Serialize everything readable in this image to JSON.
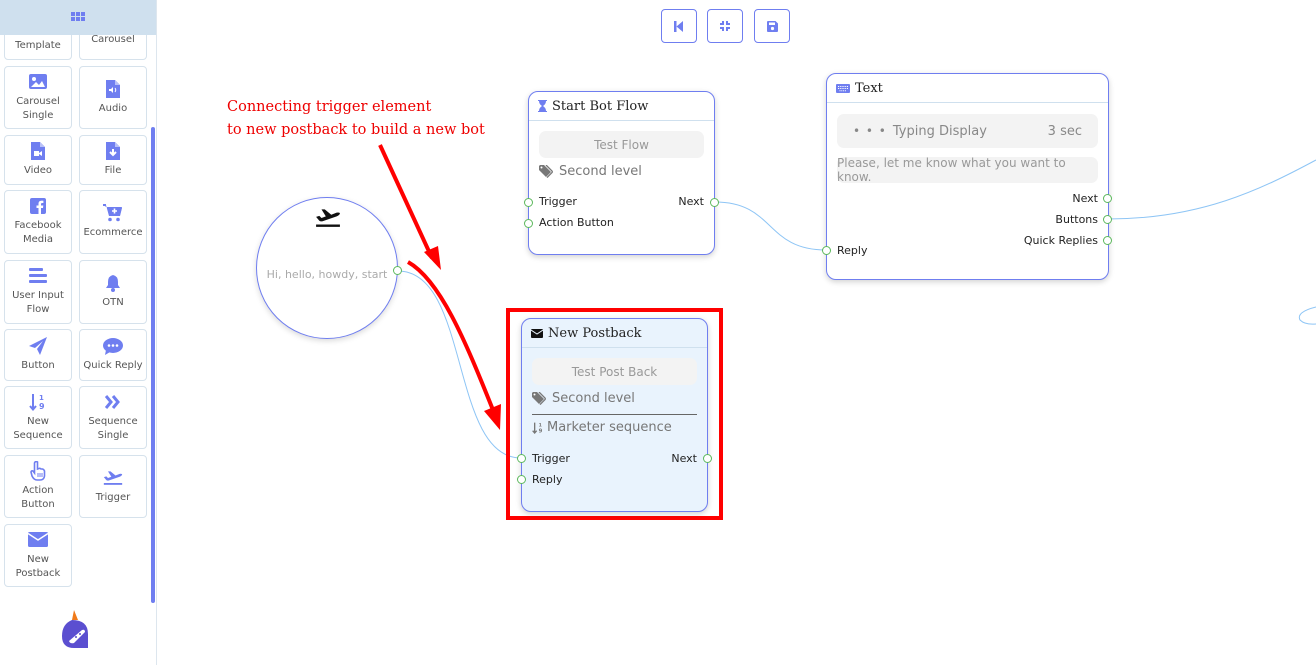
{
  "sidebar": {
    "header_icon": "grid-icon",
    "tiles": [
      {
        "label": "Generic Template",
        "icon": "generic-template-icon"
      },
      {
        "label": "Carousel",
        "icon": "carousel-icon"
      },
      {
        "label": "Carousel Single",
        "icon": "image-icon"
      },
      {
        "label": "Audio",
        "icon": "audio-file-icon"
      },
      {
        "label": "Video",
        "icon": "video-file-icon"
      },
      {
        "label": "File",
        "icon": "file-download-icon"
      },
      {
        "label": "Facebook Media",
        "icon": "facebook-icon"
      },
      {
        "label": "Ecommerce",
        "icon": "cart-plus-icon"
      },
      {
        "label": "User Input Flow",
        "icon": "bars-icon"
      },
      {
        "label": "OTN",
        "icon": "bell-icon"
      },
      {
        "label": "Button",
        "icon": "paper-plane-icon"
      },
      {
        "label": "Quick Reply",
        "icon": "comment-dots-icon"
      },
      {
        "label": "New Sequence",
        "icon": "sort-numeric-icon"
      },
      {
        "label": "Sequence Single",
        "icon": "double-chevron-right-icon"
      },
      {
        "label": "Action Button",
        "icon": "hand-pointer-icon"
      },
      {
        "label": "Trigger",
        "icon": "plane-departure-icon"
      },
      {
        "label": "New Postback",
        "icon": "envelope-icon"
      }
    ]
  },
  "toolbar": {
    "buttons": [
      {
        "name": "step-backward",
        "icon": "step-backward-icon"
      },
      {
        "name": "compress",
        "icon": "compress-icon"
      },
      {
        "name": "save",
        "icon": "save-icon"
      }
    ]
  },
  "annotation": {
    "line1": "Connecting trigger element",
    "line2": "to new postback to build a new bot",
    "color": "#ff0000"
  },
  "trigger_node": {
    "icon": "plane-departure-icon",
    "keywords": "Hi, hello, howdy, start"
  },
  "start_bot_flow": {
    "title": "Start Bot Flow",
    "icon": "hourglass-icon",
    "button": "Test Flow",
    "label": "Second level",
    "inputs": [
      "Trigger",
      "Action Button"
    ],
    "outputs": [
      "Next"
    ]
  },
  "text_node": {
    "title": "Text",
    "icon": "keyboard-icon",
    "typing_label": "Typing Display",
    "typing_value": "3 sec",
    "message": "Please, let me know what you want to know.",
    "inputs": [
      "Reply"
    ],
    "outputs": [
      "Next",
      "Buttons",
      "Quick Replies"
    ]
  },
  "new_postback": {
    "title": "New Postback",
    "icon": "envelope-icon",
    "button": "Test Post Back",
    "label": "Second level",
    "sequence": "Marketer sequence",
    "inputs": [
      "Trigger",
      "Reply"
    ],
    "outputs": [
      "Next"
    ]
  },
  "colors": {
    "accent": "#6f7ef0",
    "port": "#5cb85c",
    "connection": "#8ec5f5",
    "highlight": "#ff0000",
    "postback_bg": "#e9f3fd"
  }
}
